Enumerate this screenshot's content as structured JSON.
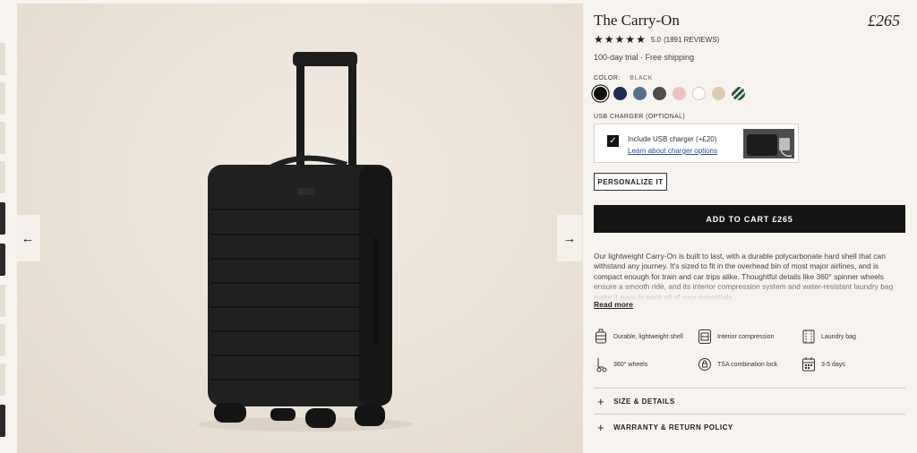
{
  "product": {
    "title": "The Carry-On",
    "price": "£265",
    "rating_value": "5.0",
    "reviews": "(1891 REVIEWS)",
    "stars": 5,
    "perks": "100-day trial · Free shipping"
  },
  "color": {
    "label": "COLOR:",
    "selected": "BLACK",
    "swatches": [
      {
        "name": "Black",
        "hex": "#111111"
      },
      {
        "name": "Navy",
        "hex": "#1f2d55"
      },
      {
        "name": "Slate Blue",
        "hex": "#56708e"
      },
      {
        "name": "Charcoal",
        "hex": "#4d4d4d"
      },
      {
        "name": "Pink",
        "hex": "#efc2c4"
      },
      {
        "name": "White",
        "hex": "#ffffff"
      },
      {
        "name": "Sand",
        "hex": "#d9cdb0"
      },
      {
        "name": "Green Stripe",
        "hex": "#1d5a3a"
      }
    ]
  },
  "usb": {
    "label": "USB CHARGER (OPTIONAL)",
    "checkbox_label": "Include USB charger (+£20)",
    "link": "Learn about charger options",
    "checked": true
  },
  "personalize_label": "PERSONALIZE IT",
  "add_to_cart_label": "ADD TO CART £265",
  "description": "Our lightweight Carry-On is built to last, with a durable polycarbonate hard shell that can withstand any journey. It's sized to fit in the overhead bin of most major airlines, and is compact enough for train and car trips alike. Thoughtful details like 360° spinner wheels ensure a smooth ride, and its interior compression system and water-resistant laundry bag make it easy to pack all of your essentials.",
  "read_more": "Read more",
  "features": [
    {
      "icon": "suitcase-icon",
      "label": "Durable, lightweight shell"
    },
    {
      "icon": "compression-icon",
      "label": "Interior compression"
    },
    {
      "icon": "laundry-bag-icon",
      "label": "Laundry bag"
    },
    {
      "icon": "wheels-icon",
      "label": "360° wheels"
    },
    {
      "icon": "lock-icon",
      "label": "TSA combination lock"
    },
    {
      "icon": "calendar-icon",
      "label": "3-5 days"
    }
  ],
  "accordions": [
    {
      "label": "SIZE & DETAILS"
    },
    {
      "label": "WARRANTY & RETURN POLICY"
    }
  ],
  "nav": {
    "prev": "←",
    "next": "→"
  }
}
